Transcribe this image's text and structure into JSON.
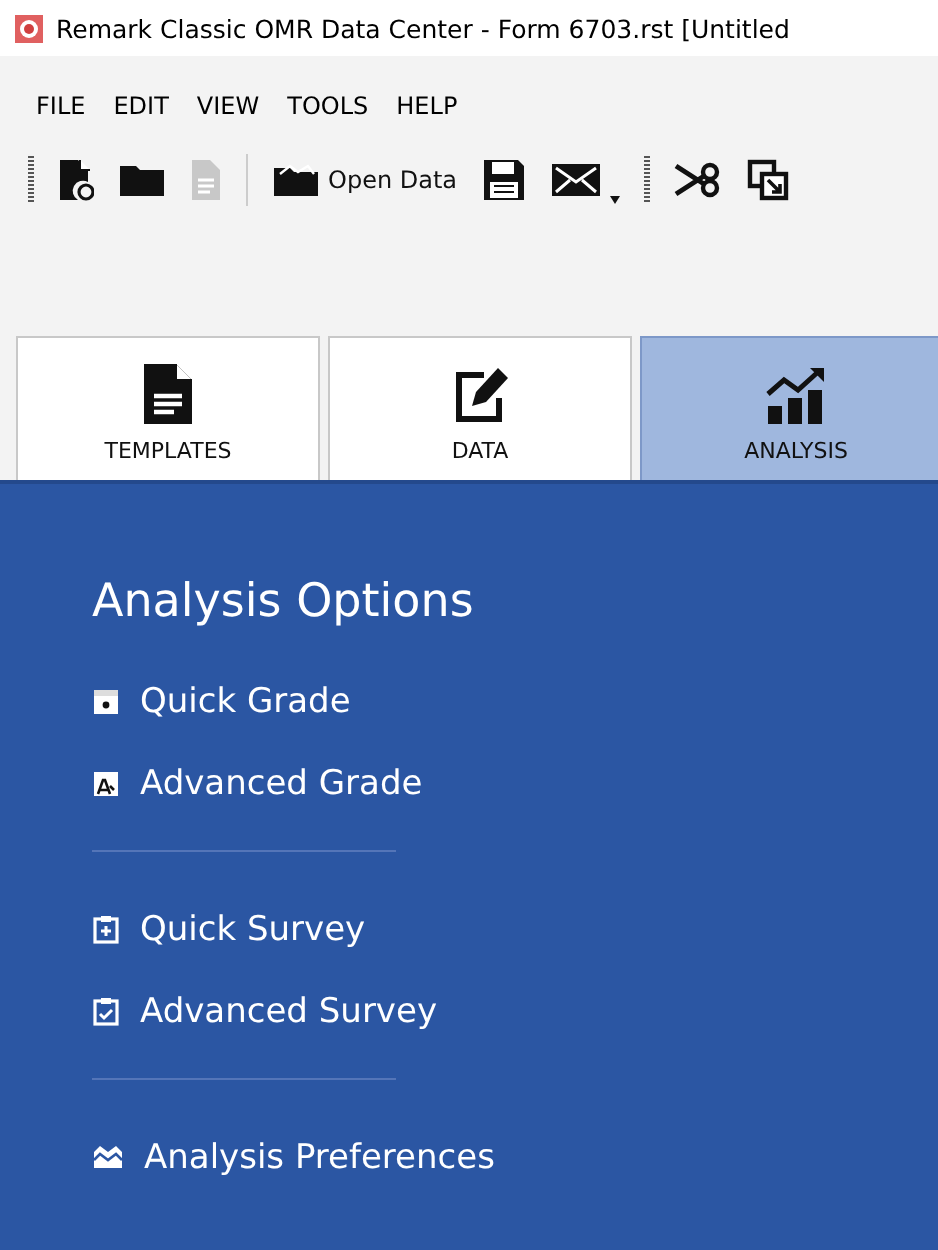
{
  "window": {
    "title": "Remark Classic OMR Data Center - Form 6703.rst [Untitled"
  },
  "menu": [
    "FILE",
    "EDIT",
    "VIEW",
    "TOOLS",
    "HELP"
  ],
  "toolbar": [
    {
      "kind": "grip"
    },
    {
      "kind": "new-file",
      "disabled": false
    },
    {
      "kind": "folder",
      "disabled": false
    },
    {
      "kind": "document",
      "disabled": true
    },
    {
      "kind": "separator"
    },
    {
      "kind": "open-data",
      "label": "Open Data",
      "disabled": false
    },
    {
      "kind": "save",
      "disabled": false
    },
    {
      "kind": "mail",
      "disabled": false
    },
    {
      "kind": "dropdown"
    },
    {
      "kind": "grip"
    },
    {
      "kind": "cut",
      "disabled": false
    },
    {
      "kind": "copy",
      "disabled": false
    }
  ],
  "tabs": [
    {
      "label": "TEMPLATES",
      "kind": "document",
      "selected": false
    },
    {
      "label": "DATA",
      "kind": "edit",
      "selected": false
    },
    {
      "label": "ANALYSIS",
      "kind": "chart",
      "selected": true
    }
  ],
  "panel": {
    "title": "Analysis Options",
    "groups": [
      [
        {
          "label": "Quick Grade",
          "kind": "grade"
        },
        {
          "label": "Advanced Grade",
          "kind": "grade-advanced"
        }
      ],
      [
        {
          "label": "Quick Survey",
          "kind": "survey"
        },
        {
          "label": "Advanced Survey",
          "kind": "survey-check"
        }
      ],
      [
        {
          "label": "Analysis Preferences",
          "kind": "preferences"
        }
      ]
    ]
  }
}
